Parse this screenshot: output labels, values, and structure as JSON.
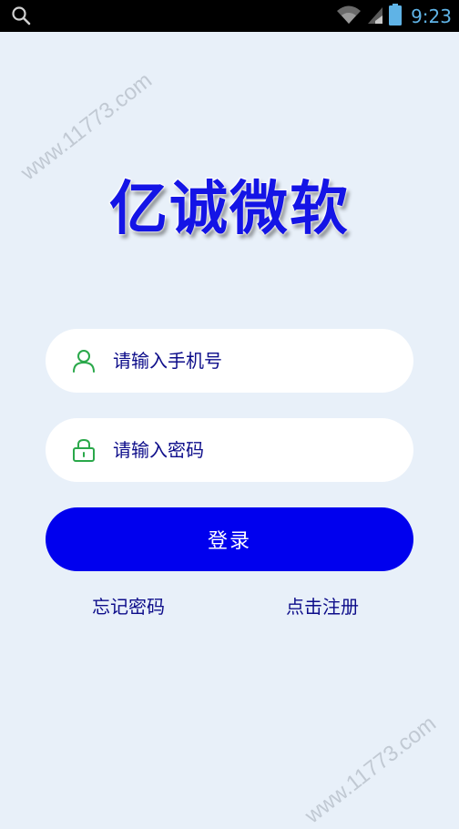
{
  "status_bar": {
    "time": "9:23",
    "icons": [
      "search-icon",
      "wifi-icon",
      "signal-icon",
      "battery-icon"
    ]
  },
  "watermark": {
    "text_top": "www.11773.com",
    "text_bottom": "www.11773.com"
  },
  "app": {
    "title": "亿诚微软"
  },
  "form": {
    "phone_placeholder": "请输入手机号",
    "password_placeholder": "请输入密码",
    "login_label": "登录",
    "forgot_label": "忘记密码",
    "register_label": "点击注册"
  },
  "colors": {
    "background": "#e8f0f9",
    "primary": "#0000ee",
    "title": "#1414e6",
    "icon_green": "#2aa84a",
    "text": "#0d0d8a",
    "status_icon": "#5fb3e6"
  }
}
